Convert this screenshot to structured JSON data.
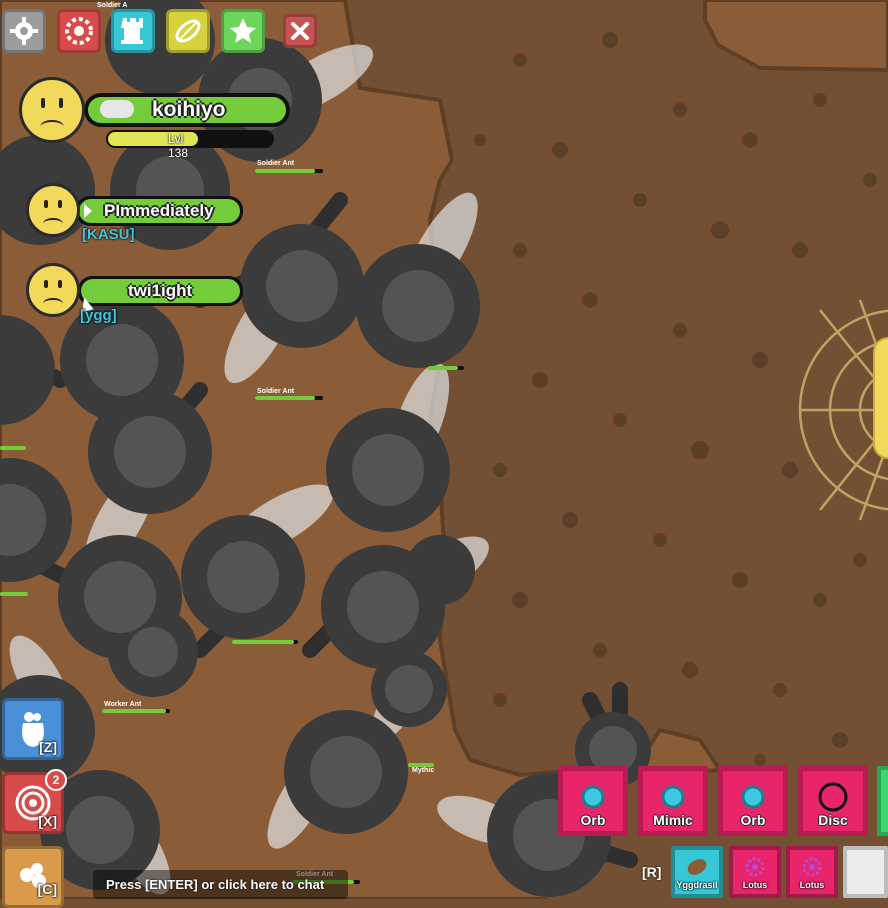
{
  "top_buttons": [
    {
      "name": "settings-button",
      "icon": "gear-icon",
      "color": "#9c9c9c"
    },
    {
      "name": "petal-gallery-button",
      "icon": "flower-icon",
      "color": "#d94b4b"
    },
    {
      "name": "inventory-button",
      "icon": "tower-icon",
      "color": "#36c8d6"
    },
    {
      "name": "crafting-button",
      "icon": "leaf-icon",
      "color": "#d6d23e"
    },
    {
      "name": "favorites-button",
      "icon": "star-icon",
      "color": "#6bd65a"
    },
    {
      "name": "close-button",
      "icon": "close-icon",
      "color": "#c95353"
    }
  ],
  "top_label": "Soldier A",
  "self_player": {
    "name": "koihiyo",
    "level": "Lvl 138"
  },
  "players": [
    {
      "name": "PImmediately",
      "squad": "[KASU]"
    },
    {
      "name": "twi1ight",
      "squad": "[ygg]"
    }
  ],
  "mob_labels": {
    "soldier": "Soldier Ant",
    "worker": "Worker Ant",
    "rarity": "Mythic"
  },
  "abilities": [
    {
      "key": "[Z]",
      "icon": "bag-icon",
      "color": "#4a90d9"
    },
    {
      "key": "[X]",
      "icon": "swirl-icon",
      "color": "#d94b4b",
      "badge": "2"
    },
    {
      "key": "[C]",
      "icon": "petals-icon",
      "color": "#d99a4b"
    }
  ],
  "loadout": {
    "primary": [
      {
        "label": "Orb",
        "icon": "orb-icon"
      },
      {
        "label": "Mimic",
        "icon": "orb-icon"
      },
      {
        "label": "Orb",
        "icon": "orb-icon"
      },
      {
        "label": "Disc",
        "icon": "disc-icon"
      }
    ],
    "swap_key": "[R]",
    "secondary": [
      {
        "label": "Yggdrasil",
        "icon": "leaf-icon",
        "color": "#36c8d6"
      },
      {
        "label": "Lotus",
        "icon": "lotus-icon",
        "color": "#e8246a"
      },
      {
        "label": "Lotus",
        "icon": "lotus-icon",
        "color": "#e8246a"
      }
    ]
  },
  "chat_prompt": "Press [ENTER] or click here to chat",
  "colors": {
    "dirt": "#8a5d38",
    "dark_ground": "#735034",
    "health": "#74cc3b",
    "rare_petal": "#e8246a"
  }
}
